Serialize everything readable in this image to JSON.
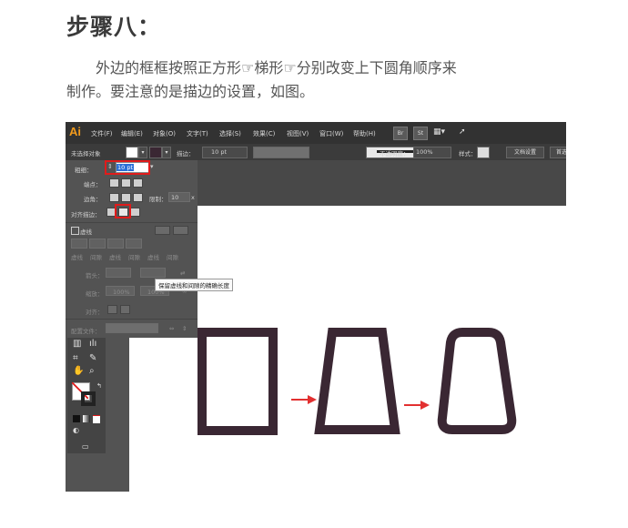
{
  "heading": "步骤八：",
  "paragraph": {
    "line1": "外边的框框按照正方形☞梯形☞分别改变上下圆角顺序来",
    "line2": "制作。要注意的是描边的设置，如图。"
  },
  "app": {
    "logo": "Ai",
    "menu": [
      "文件(F)",
      "编辑(E)",
      "对象(O)",
      "文字(T)",
      "选择(S)",
      "效果(C)",
      "视图(V)",
      "窗口(W)",
      "帮助(H)"
    ],
    "bridge_buttons": [
      "Br",
      "St"
    ],
    "layout_icon": "grid-icon",
    "rocket_icon": "rocket-icon"
  },
  "control_bar": {
    "no_selection": "未选择对象",
    "stroke_label": "描边：",
    "stroke_value": "10 pt",
    "opacity_label": "不透明度：",
    "opacity_value": "100%",
    "style_label": "样式：",
    "doc_settings": "文档设置",
    "prefs": "首选"
  },
  "stroke_panel": {
    "weight_label": "粗细：",
    "weight_value": "10 pt",
    "cap_label": "端点：",
    "corner_label": "边角：",
    "limit_label": "限制：",
    "limit_value": "10",
    "limit_unit": "x",
    "align_label": "对齐描边：",
    "dashed_label": "虚线",
    "dash_cols": [
      "虚线",
      "间隙",
      "虚线",
      "间隙",
      "虚线",
      "间隙"
    ],
    "arrow_label": "箭头：",
    "scale_label": "缩放：",
    "scale1": "100%",
    "scale2": "100%",
    "align_arrow_label": "对齐：",
    "profile_label": "配置文件："
  },
  "tooltip": "保留虚线和间隙的精确长度",
  "colors": {
    "shape_stroke": "#3a2733",
    "arrow": "#e23030",
    "highlight": "#e01b1b",
    "accent": "#f39b1c"
  }
}
